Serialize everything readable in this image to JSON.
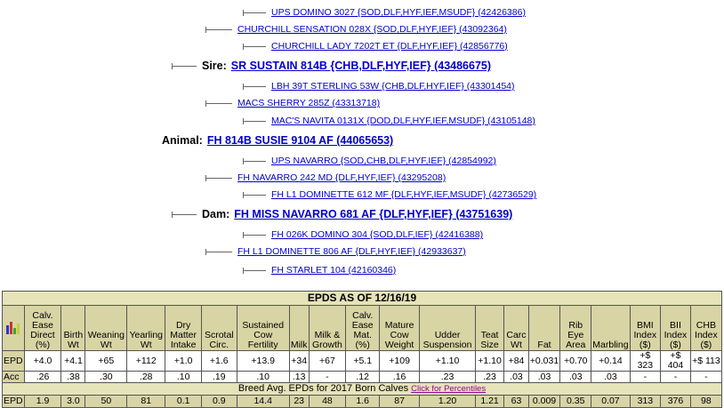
{
  "pedigree": {
    "sire_label": "Sire:",
    "animal_label": "Animal:",
    "dam_label": "Dam:",
    "sss": "UPS DOMINO 3027 {SOD,DLF,HYF,IEF,MSUDF} (42426386)",
    "ss": "CHURCHILL SENSATION 028X {SOD,DLF,HYF,IEF} (43092364)",
    "ssd": "CHURCHILL LADY 7202T ET {DLF,HYF,IEF} (42856776)",
    "sire": "SR SUSTAIN 814B {CHB,DLF,HYF,IEF} (43486675)",
    "sds": "LBH 39T STERLING 53W {CHB,DLF,HYF,IEF} (43301454)",
    "sd": "MACS SHERRY 285Z (43313718)",
    "sdd": "MAC'S NAVITA 0131X {DOD,DLF,HYF,IEF,MSUDF} (43105148)",
    "animal": "FH 814B SUSIE 9104 AF (44065653)",
    "dss": "UPS NAVARRO {SOD,CHB,DLF,HYF,IEF} (42854992)",
    "ds": "FH NAVARRO 242 MD {DLF,HYF,IEF} (43295208)",
    "dsd": "FH L1 DOMINETTE 612 MF {DLF,HYF,IEF,MSUDF} (42736529)",
    "dam": "FH MISS NAVARRO 681 AF {DLF,HYF,IEF} (43751639)",
    "dds": "FH 026K DOMINO 304 {SOD,DLF,IEF} (42416388)",
    "dd": "FH L1 DOMINETTE 806 AF {DLF,HYF,IEF} (42933637)",
    "ddd": "FH STARLET 104 (42160346)"
  },
  "epds": {
    "title": "EPDS AS OF 12/16/19",
    "chart_icon": "bar-chart-icon",
    "headers": [
      "Calv. Ease Direct (%)",
      "Birth Wt",
      "Weaning Wt",
      "Yearling Wt",
      "Dry Matter Intake",
      "Scrotal Circ.",
      "Sustained Cow Fertility",
      "Milk",
      "Milk & Growth",
      "Calv. Ease Mat. (%)",
      "Mature Cow Weight",
      "Udder Suspension",
      "Teat Size",
      "Carc Wt",
      "Fat",
      "Rib Eye Area",
      "Marbling",
      "BMI Index ($)",
      "BII Index ($)",
      "CHB Index ($)"
    ],
    "epd_label": "EPD",
    "acc_label": "Acc",
    "epd": [
      "+4.0",
      "+4.1",
      "+65",
      "+112",
      "+1.0",
      "+1.6",
      "+13.9",
      "+34",
      "+67",
      "+5.1",
      "+109",
      "+1.10",
      "+1.10",
      "+84",
      "+0.031",
      "+0.70",
      "+0.14",
      "+$ 323",
      "+$ 404",
      "+$ 113"
    ],
    "acc": [
      ".26",
      ".38",
      ".30",
      ".28",
      ".10",
      ".19",
      ".10",
      ".13",
      "-",
      ".12",
      ".16",
      ".23",
      ".23",
      ".03",
      ".03",
      ".03",
      ".03",
      "-",
      "-",
      "-"
    ],
    "breed_text": "Breed Avg. EPDs for 2017 Born Calves",
    "percentiles_link": "Click for Percentiles",
    "breed_label": "EPD",
    "breed": [
      "1.9",
      "3.0",
      "50",
      "81",
      "0.1",
      "0.9",
      "14.4",
      "23",
      "48",
      "1.6",
      "87",
      "1.20",
      "1.21",
      "63",
      "0.009",
      "0.35",
      "0.07",
      "313",
      "376",
      "98"
    ]
  }
}
